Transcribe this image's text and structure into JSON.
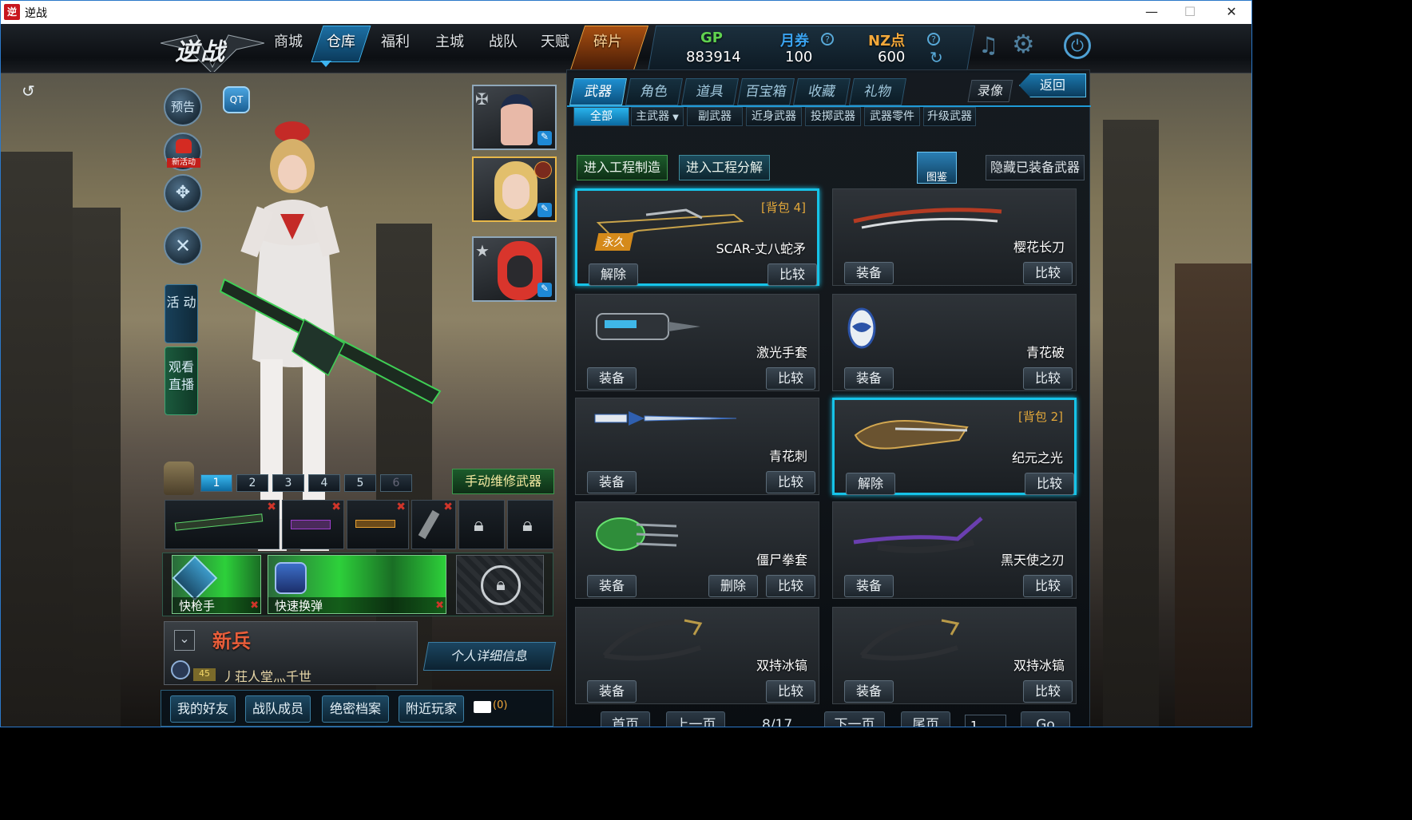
{
  "window": {
    "title": "逆战",
    "app_icon": "逆",
    "minimize": "—",
    "maximize": "☐",
    "close": "✕"
  },
  "nav": {
    "logo": "逆战",
    "items": [
      "商城",
      "仓库",
      "福利",
      "主城",
      "战队",
      "天赋",
      "碎片"
    ]
  },
  "currency": {
    "gp_label": "GP",
    "gp_value": "883914",
    "ticket_label": "月券",
    "ticket_value": "100",
    "nz_label": "NZ点",
    "nz_value": "600"
  },
  "left": {
    "preview": "预告",
    "new_activity": "新活动",
    "activity": "活 动",
    "watch_live": "观看 直播"
  },
  "tabs": {
    "main": [
      "武器",
      "角色",
      "道具",
      "百宝箱",
      "收藏",
      "礼物"
    ],
    "record": "录像",
    "back": "返回",
    "sub": [
      "全部",
      "主武器",
      "副武器",
      "近身武器",
      "投掷武器",
      "武器零件",
      "升级武器"
    ]
  },
  "actions": {
    "craft": "进入工程制造",
    "decompose": "进入工程分解",
    "handbook": "图鉴",
    "hide_equipped": "隐藏已装备武器"
  },
  "weapons": [
    {
      "name": "SCAR-丈八蛇矛",
      "bag": "[背包 4]",
      "perm": "永久",
      "action": "解除",
      "compare": "比较",
      "equipped": true
    },
    {
      "name": "樱花长刀",
      "action": "装备",
      "compare": "比较"
    },
    {
      "name": "激光手套",
      "action": "装备",
      "compare": "比较"
    },
    {
      "name": "青花破",
      "action": "装备",
      "compare": "比较"
    },
    {
      "name": "青花刺",
      "action": "装备",
      "compare": "比较"
    },
    {
      "name": "纪元之光",
      "bag": "[背包 2]",
      "action": "解除",
      "compare": "比较",
      "equipped": true
    },
    {
      "name": "僵尸拳套",
      "action": "装备",
      "delete": "删除",
      "compare": "比较"
    },
    {
      "name": "黑天使之刃",
      "action": "装备",
      "compare": "比较"
    },
    {
      "name": "双持冰镐",
      "action": "装备",
      "compare": "比较"
    },
    {
      "name": "双持冰镐",
      "action": "装备",
      "compare": "比较"
    }
  ],
  "pagination": {
    "first": "首页",
    "prev": "上一页",
    "current": "8/17",
    "next": "下一页",
    "last": "尾页",
    "page_input": "1",
    "go": "Go"
  },
  "loadout": {
    "slots": [
      "1",
      "2",
      "3",
      "4",
      "5",
      "6"
    ],
    "repair": "手动维修武器"
  },
  "skills": [
    {
      "name": "快枪手"
    },
    {
      "name": "快速换弹"
    }
  ],
  "player": {
    "rank": "新兵",
    "level": "45",
    "name": "丿荘人堂灬千世",
    "details": "个人详细信息"
  },
  "bottom": {
    "friends": "我的好友",
    "team": "战队成员",
    "secret": "绝密档案",
    "nearby": "附近玩家",
    "mail_count": "(0)"
  },
  "colors": {
    "accent": "#16c3e8",
    "gp": "#5fd14f",
    "ticket": "#3aa3f0",
    "nz": "#f3a83a"
  }
}
